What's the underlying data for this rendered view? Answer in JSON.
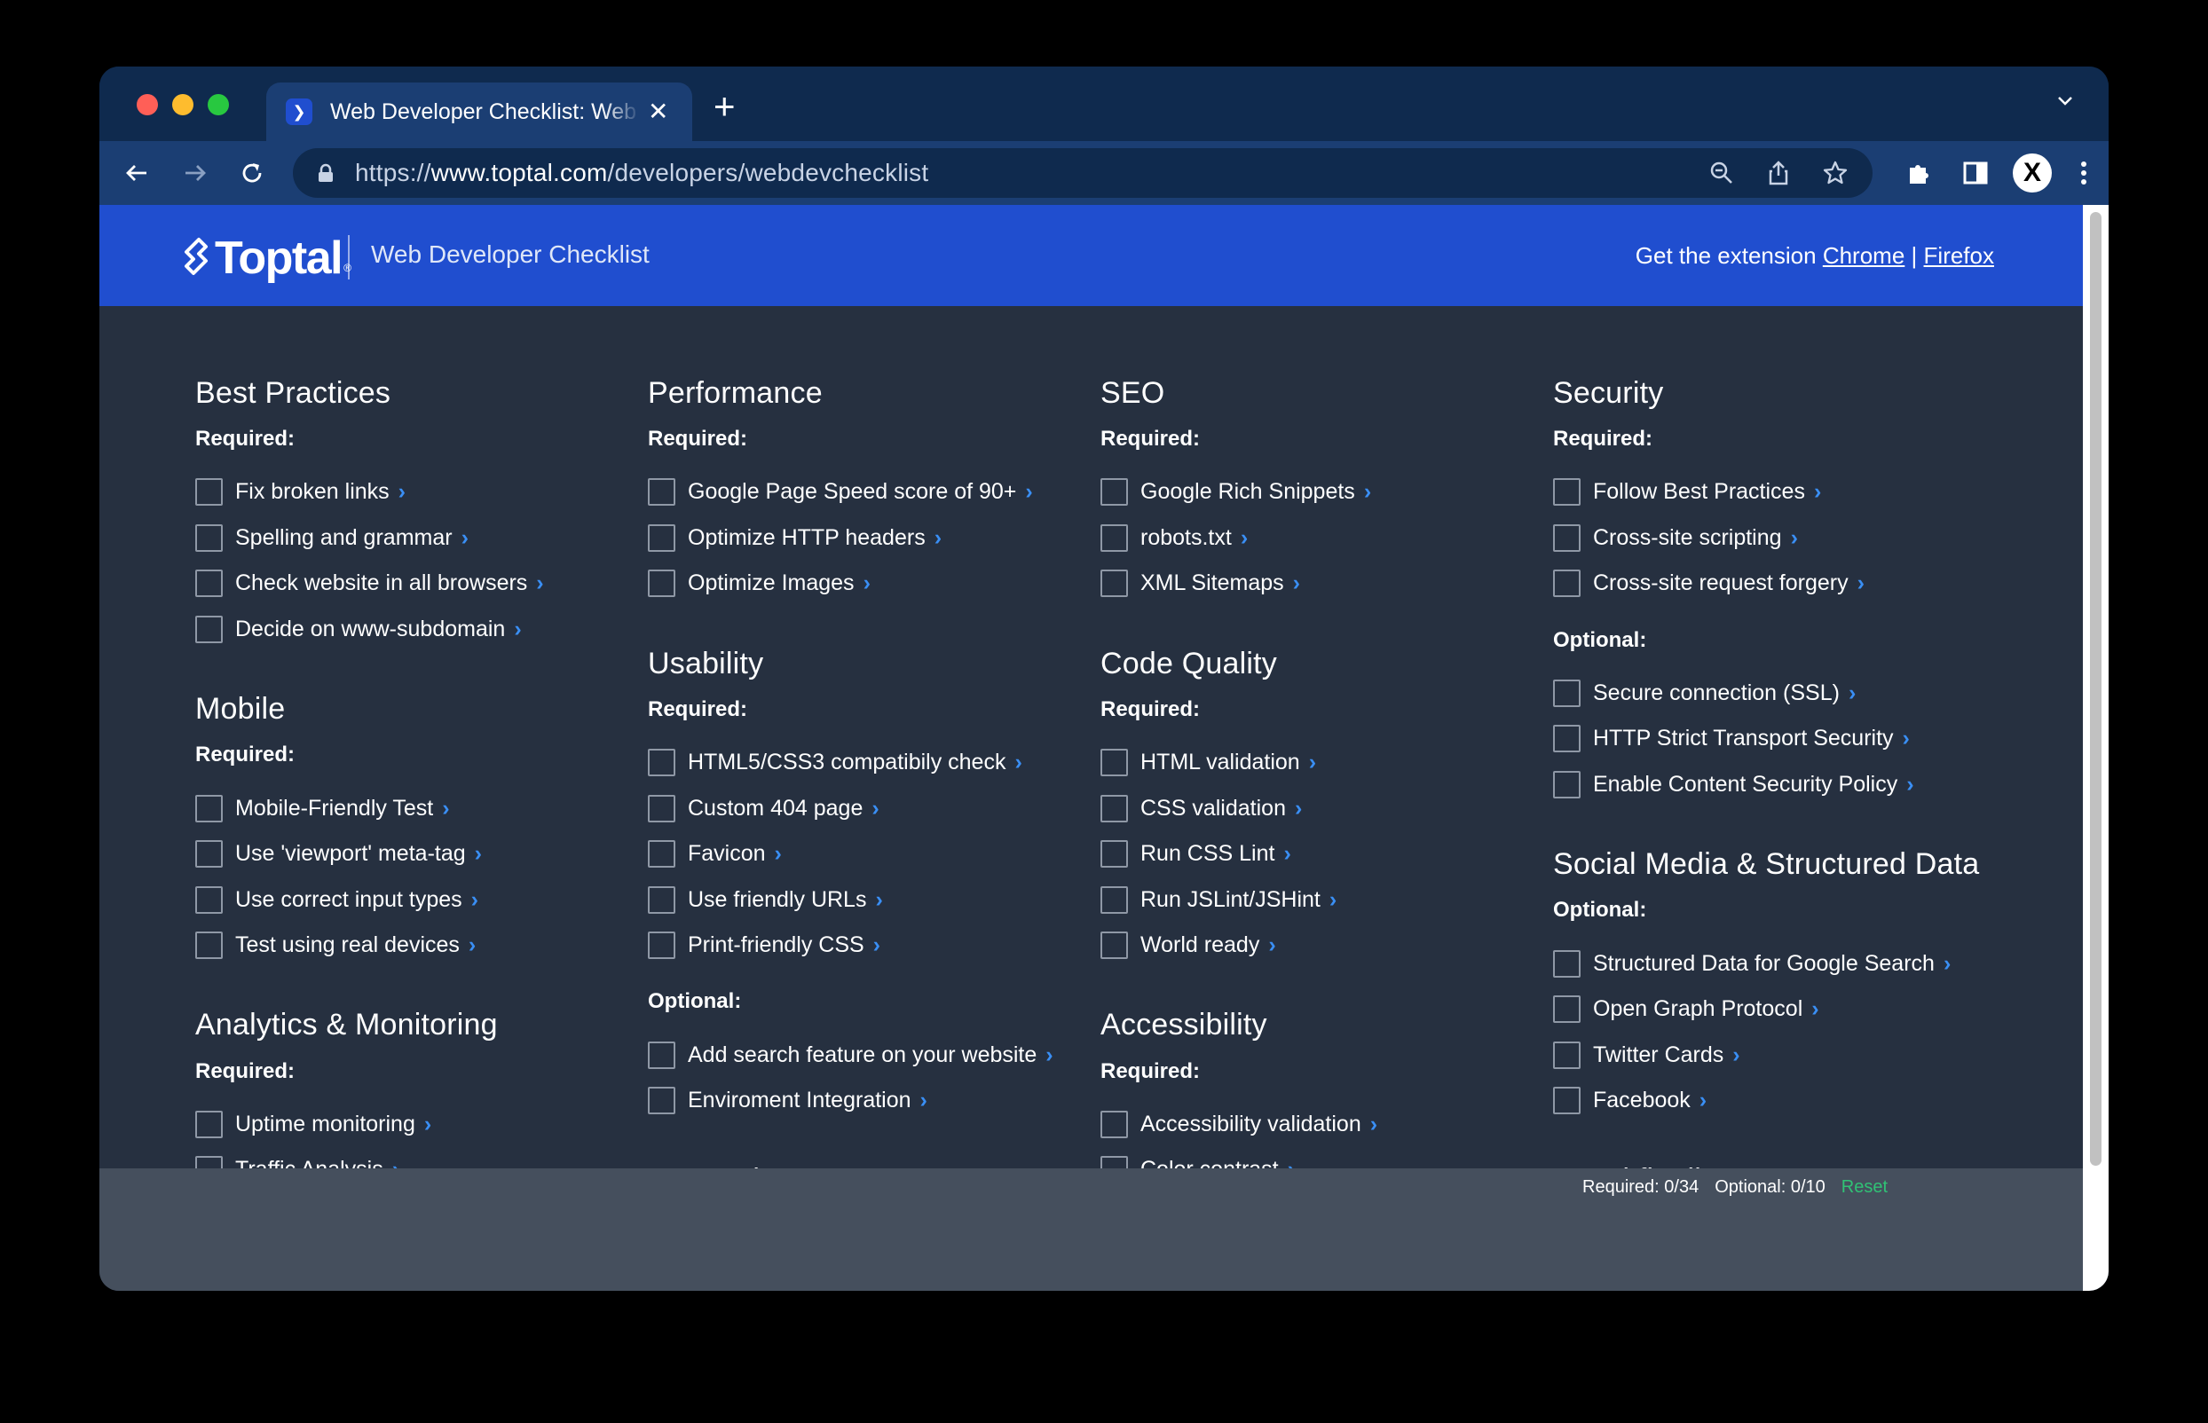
{
  "browser": {
    "tab_title": "Web Developer Checklist: Web",
    "url_scheme": "https://",
    "url_host": "www.toptal.com",
    "url_path": "/developers/webdevchecklist",
    "profile_initial": "X"
  },
  "header": {
    "logo": "Toptal",
    "title": "Web Developer Checklist",
    "extension_prefix": "Get the extension",
    "chrome_link": "Chrome",
    "separator": "|",
    "firefox_link": "Firefox"
  },
  "columns": [
    {
      "sections": [
        {
          "title": "Best Practices",
          "groups": [
            {
              "label": "Required:",
              "items": [
                "Fix broken links",
                "Spelling and grammar",
                "Check website in all browsers",
                "Decide on www-subdomain"
              ]
            }
          ]
        },
        {
          "title": "Mobile",
          "groups": [
            {
              "label": "Required:",
              "items": [
                "Mobile-Friendly Test",
                "Use 'viewport' meta-tag",
                "Use correct input types",
                "Test using real devices"
              ]
            }
          ]
        },
        {
          "title": "Analytics & Monitoring",
          "groups": [
            {
              "label": "Required:",
              "items": [
                "Uptime monitoring",
                "Traffic Analysis"
              ]
            }
          ]
        }
      ]
    },
    {
      "sections": [
        {
          "title": "Performance",
          "groups": [
            {
              "label": "Required:",
              "items": [
                "Google Page Speed score of 90+",
                "Optimize HTTP headers",
                "Optimize Images"
              ]
            }
          ]
        },
        {
          "title": "Usability",
          "groups": [
            {
              "label": "Required:",
              "items": [
                "HTML5/CSS3 compatibily check",
                "Custom 404 page",
                "Favicon",
                "Use friendly URLs",
                "Print-friendly CSS"
              ]
            },
            {
              "label": "Optional:",
              "items": [
                "Add search feature on your website",
                "Enviroment Integration"
              ]
            }
          ]
        },
        {
          "title": "Semantics",
          "groups": []
        }
      ]
    },
    {
      "sections": [
        {
          "title": "SEO",
          "groups": [
            {
              "label": "Required:",
              "items": [
                "Google Rich Snippets",
                "robots.txt",
                "XML Sitemaps"
              ]
            }
          ]
        },
        {
          "title": "Code Quality",
          "groups": [
            {
              "label": "Required:",
              "items": [
                "HTML validation",
                "CSS validation",
                "Run CSS Lint",
                "Run JSLint/JSHint",
                "World ready"
              ]
            }
          ]
        },
        {
          "title": "Accessibility",
          "groups": [
            {
              "label": "Required:",
              "items": [
                "Accessibility validation",
                "Color contrast"
              ]
            }
          ]
        }
      ]
    },
    {
      "sections": [
        {
          "title": "Security",
          "groups": [
            {
              "label": "Required:",
              "items": [
                "Follow Best Practices",
                "Cross-site scripting",
                "Cross-site request forgery"
              ]
            },
            {
              "label": "Optional:",
              "items": [
                "Secure connection (SSL)",
                "HTTP Strict Transport Security",
                "Enable Content Security Policy"
              ]
            }
          ]
        },
        {
          "title": "Social Media & Structured Data",
          "groups": [
            {
              "label": "Optional:",
              "items": [
                "Structured Data for Google Search",
                "Open Graph Protocol",
                "Twitter Cards",
                "Facebook"
              ]
            }
          ]
        },
        {
          "title": "...and finally",
          "groups": []
        }
      ]
    }
  ],
  "footer": {
    "required": "Required: 0/34",
    "optional": "Optional: 0/10",
    "reset": "Reset"
  },
  "colors": {
    "brand_blue": "#204ecf",
    "page_bg": "#263040",
    "chevron": "#3a8ff5",
    "reset": "#30c275"
  }
}
